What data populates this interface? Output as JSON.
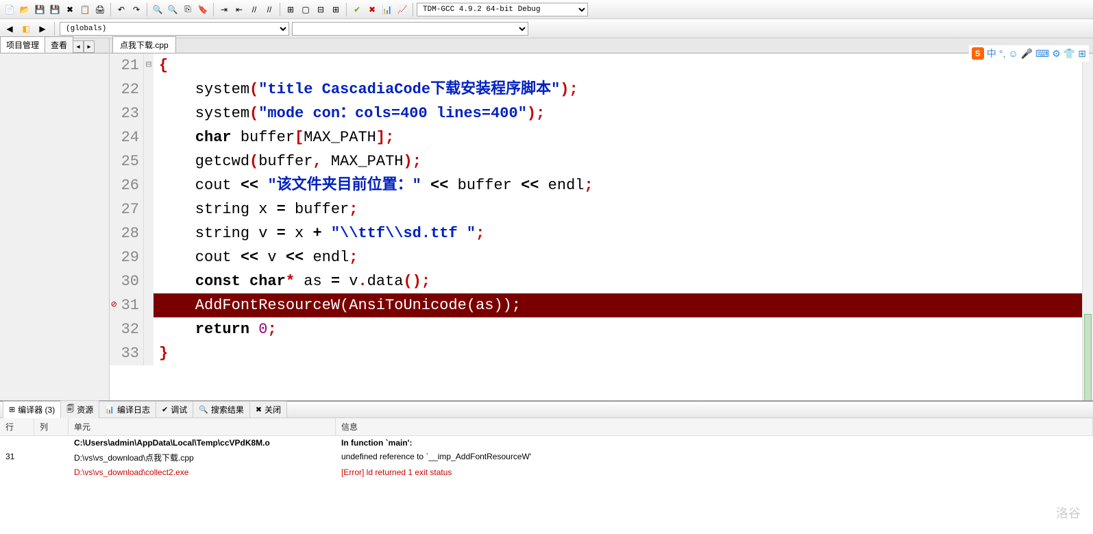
{
  "toolbar": {
    "compiler_combo": "TDM-GCC 4.9.2 64-bit Debug"
  },
  "toolbar2": {
    "scope_combo": "(globals)"
  },
  "left_panel": {
    "tabs": [
      "项目管理",
      "查看"
    ]
  },
  "file_tabs": {
    "active": "点我下载.cpp"
  },
  "code": {
    "lines": [
      {
        "n": 21,
        "fold": "⊟",
        "tokens": [
          {
            "t": "{",
            "c": "brace"
          }
        ]
      },
      {
        "n": 22,
        "tokens": [
          {
            "t": "    system",
            "c": "fn"
          },
          {
            "t": "(",
            "c": "sym"
          },
          {
            "t": "\"title CascadiaCode下载安装程序脚本\"",
            "c": "str"
          },
          {
            "t": ")",
            "c": "sym"
          },
          {
            "t": ";",
            "c": "sym"
          }
        ]
      },
      {
        "n": 23,
        "tokens": [
          {
            "t": "    system",
            "c": "fn"
          },
          {
            "t": "(",
            "c": "sym"
          },
          {
            "t": "\"mode con：cols=400 lines=400\"",
            "c": "str"
          },
          {
            "t": ")",
            "c": "sym"
          },
          {
            "t": ";",
            "c": "sym"
          }
        ]
      },
      {
        "n": 24,
        "tokens": [
          {
            "t": "    ",
            "c": ""
          },
          {
            "t": "char",
            "c": "kw"
          },
          {
            "t": " buffer",
            "c": ""
          },
          {
            "t": "[",
            "c": "sym"
          },
          {
            "t": "MAX_PATH",
            "c": ""
          },
          {
            "t": "]",
            "c": "sym"
          },
          {
            "t": ";",
            "c": "sym"
          }
        ]
      },
      {
        "n": 25,
        "tokens": [
          {
            "t": "    getcwd",
            "c": "fn"
          },
          {
            "t": "(",
            "c": "sym"
          },
          {
            "t": "buffer",
            "c": ""
          },
          {
            "t": ",",
            "c": "sym"
          },
          {
            "t": " MAX_PATH",
            "c": ""
          },
          {
            "t": ")",
            "c": "sym"
          },
          {
            "t": ";",
            "c": "sym"
          }
        ]
      },
      {
        "n": 26,
        "tokens": [
          {
            "t": "    cout ",
            "c": ""
          },
          {
            "t": "<<",
            "c": "op"
          },
          {
            "t": " ",
            "c": ""
          },
          {
            "t": "\"该文件夹目前位置：\"",
            "c": "str"
          },
          {
            "t": " ",
            "c": ""
          },
          {
            "t": "<<",
            "c": "op"
          },
          {
            "t": " buffer ",
            "c": ""
          },
          {
            "t": "<<",
            "c": "op"
          },
          {
            "t": " endl",
            "c": ""
          },
          {
            "t": ";",
            "c": "sym"
          }
        ]
      },
      {
        "n": 27,
        "tokens": [
          {
            "t": "    string x ",
            "c": ""
          },
          {
            "t": "=",
            "c": "op"
          },
          {
            "t": " buffer",
            "c": ""
          },
          {
            "t": ";",
            "c": "sym"
          }
        ]
      },
      {
        "n": 28,
        "tokens": [
          {
            "t": "    string v ",
            "c": ""
          },
          {
            "t": "=",
            "c": "op"
          },
          {
            "t": " x ",
            "c": ""
          },
          {
            "t": "+",
            "c": "op"
          },
          {
            "t": " ",
            "c": ""
          },
          {
            "t": "\"\\\\ttf\\\\sd.ttf \"",
            "c": "str"
          },
          {
            "t": ";",
            "c": "sym"
          }
        ]
      },
      {
        "n": 29,
        "tokens": [
          {
            "t": "    cout ",
            "c": ""
          },
          {
            "t": "<<",
            "c": "op"
          },
          {
            "t": " v ",
            "c": ""
          },
          {
            "t": "<<",
            "c": "op"
          },
          {
            "t": " endl",
            "c": ""
          },
          {
            "t": ";",
            "c": "sym"
          }
        ]
      },
      {
        "n": 30,
        "tokens": [
          {
            "t": "    ",
            "c": ""
          },
          {
            "t": "const",
            "c": "kw"
          },
          {
            "t": " ",
            "c": ""
          },
          {
            "t": "char",
            "c": "kw"
          },
          {
            "t": "*",
            "c": "sym"
          },
          {
            "t": " as ",
            "c": ""
          },
          {
            "t": "=",
            "c": "op"
          },
          {
            "t": " v",
            "c": ""
          },
          {
            "t": ".",
            "c": "sym"
          },
          {
            "t": "data",
            "c": "fn"
          },
          {
            "t": "()",
            "c": "sym"
          },
          {
            "t": ";",
            "c": "sym"
          }
        ]
      },
      {
        "n": 31,
        "err": true,
        "hl": true,
        "tokens": [
          {
            "t": "    AddFontResourceW(AnsiToUnicode(as));",
            "c": ""
          }
        ]
      },
      {
        "n": 32,
        "tokens": [
          {
            "t": "    ",
            "c": ""
          },
          {
            "t": "return",
            "c": "kw"
          },
          {
            "t": " ",
            "c": ""
          },
          {
            "t": "0",
            "c": "num"
          },
          {
            "t": ";",
            "c": "sym"
          }
        ]
      },
      {
        "n": 33,
        "tokens": [
          {
            "t": "}",
            "c": "brace"
          }
        ]
      }
    ]
  },
  "bottom": {
    "tabs": [
      {
        "icon": "⊞",
        "label": "编译器 (3)",
        "active": true
      },
      {
        "icon": "🗐",
        "label": "资源"
      },
      {
        "icon": "📊",
        "label": "编译日志"
      },
      {
        "icon": "✔",
        "label": "调试"
      },
      {
        "icon": "🔍",
        "label": "搜索结果"
      },
      {
        "icon": "✖",
        "label": "关闭"
      }
    ],
    "headers": {
      "line": "行",
      "col": "列",
      "unit": "单元",
      "msg": "信息"
    },
    "rows": [
      {
        "line": "",
        "col": "",
        "unit": "C:\\Users\\admin\\AppData\\Local\\Temp\\ccVPdK8M.o",
        "msg": "In function `main':",
        "bold": true
      },
      {
        "line": "31",
        "col": "",
        "unit": "D:\\vs\\vs_download\\点我下载.cpp",
        "msg": "undefined reference to `__imp_AddFontResourceW'"
      },
      {
        "line": "",
        "col": "",
        "unit": "D:\\vs\\vs_download\\collect2.exe",
        "msg": "[Error] ld returned 1 exit status",
        "red": true
      }
    ]
  },
  "ime": {
    "lang": "中"
  },
  "watermark": "洛谷"
}
